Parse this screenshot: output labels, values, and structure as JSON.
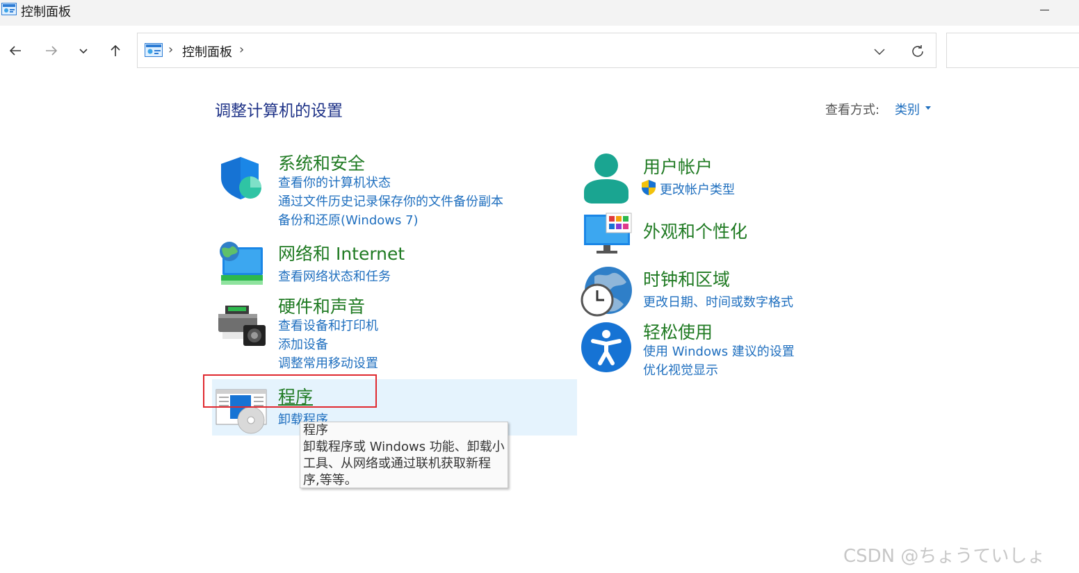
{
  "window": {
    "title": "控制面板"
  },
  "address": {
    "crumb": "控制面板",
    "separator": "›"
  },
  "header": {
    "title": "调整计算机的设置",
    "view_by_label": "查看方式:",
    "view_by_value": "类别"
  },
  "categories_left": [
    {
      "title": "系统和安全",
      "icon": "shield-icon",
      "links": [
        "查看你的计算机状态",
        "通过文件历史记录保存你的文件备份副本",
        "备份和还原(Windows 7)"
      ]
    },
    {
      "title": "网络和 Internet",
      "icon": "network-icon",
      "links": [
        "查看网络状态和任务"
      ]
    },
    {
      "title": "硬件和声音",
      "icon": "printer-icon",
      "links": [
        "查看设备和打印机",
        "添加设备",
        "调整常用移动设置"
      ]
    },
    {
      "title": "程序",
      "icon": "programs-icon",
      "links": [
        "卸载程序"
      ]
    }
  ],
  "categories_right": [
    {
      "title": "用户帐户",
      "icon": "user-icon",
      "links": [
        "更改帐户类型"
      ]
    },
    {
      "title": "外观和个性化",
      "icon": "monitor-icon",
      "links": []
    },
    {
      "title": "时钟和区域",
      "icon": "clock-globe-icon",
      "links": [
        "更改日期、时间或数字格式"
      ]
    },
    {
      "title": "轻松使用",
      "icon": "accessibility-icon",
      "links": [
        "使用 Windows 建议的设置",
        "优化视觉显示"
      ]
    }
  ],
  "tooltip": {
    "title": "程序",
    "body": "卸载程序或 Windows 功能、卸载小工具、从网络或通过联机获取新程序,等等。"
  },
  "watermark": "CSDN @ちょうていしょ",
  "colors": {
    "category_green": "#1f7a22",
    "link_blue": "#1f6fbf",
    "title_navy": "#1e3287",
    "highlight_red": "#e0282e",
    "hover_bg": "#e5f3fd"
  }
}
